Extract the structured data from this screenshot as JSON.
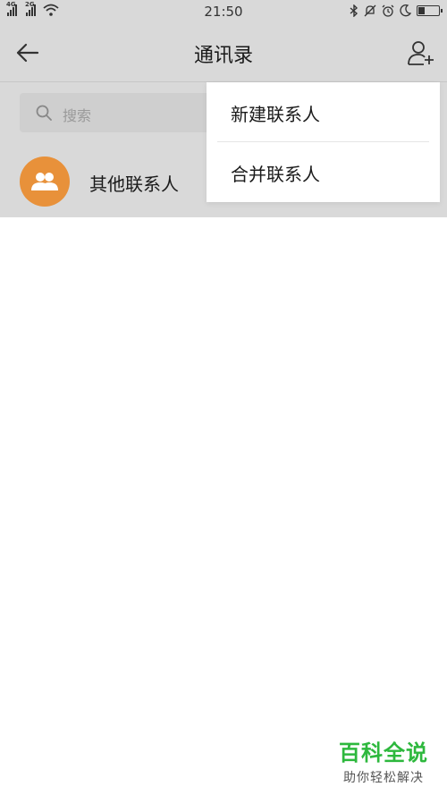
{
  "status_bar": {
    "net1": "4G",
    "net2": "2G",
    "time": "21:50"
  },
  "nav": {
    "title": "通讯录"
  },
  "search": {
    "placeholder": "搜索"
  },
  "contacts": [
    {
      "name": "其他联系人"
    }
  ],
  "popup_menu": {
    "items": [
      {
        "label": "新建联系人"
      },
      {
        "label": "合并联系人"
      }
    ]
  },
  "watermark": {
    "title": "百科全说",
    "subtitle": "助你轻松解决"
  },
  "colors": {
    "dimmed_background": "#d9d9d9",
    "avatar": "#e8913a",
    "watermark_green": "#2db83d"
  }
}
